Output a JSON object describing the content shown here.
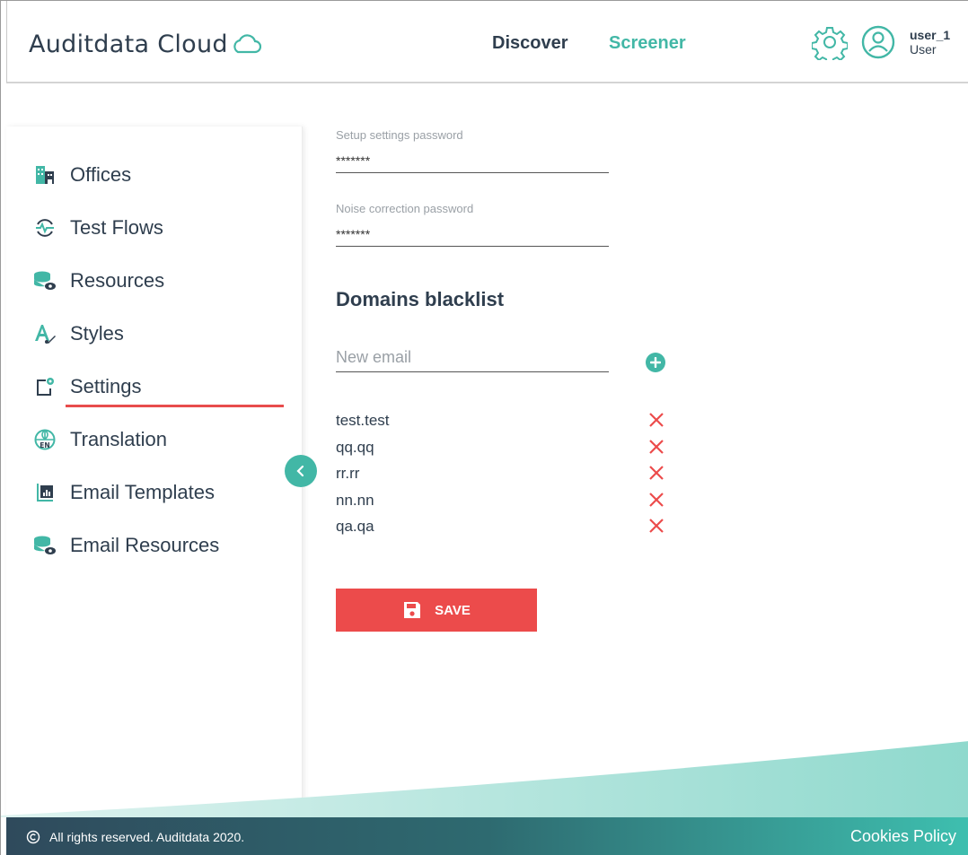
{
  "header": {
    "logo_text": "Auditdata Cloud",
    "nav": [
      {
        "label": "Discover",
        "active": false
      },
      {
        "label": "Screener",
        "active": true
      }
    ],
    "user": {
      "name": "user_1",
      "role": "User"
    }
  },
  "sidebar": {
    "items": [
      {
        "label": "Offices",
        "icon": "building-icon"
      },
      {
        "label": "Test Flows",
        "icon": "test-flow-icon"
      },
      {
        "label": "Resources",
        "icon": "database-eye-icon"
      },
      {
        "label": "Styles",
        "icon": "font-brush-icon"
      },
      {
        "label": "Settings",
        "icon": "device-gear-icon",
        "active": true
      },
      {
        "label": "Translation",
        "icon": "globe-en-icon"
      },
      {
        "label": "Email Templates",
        "icon": "report-file-icon"
      },
      {
        "label": "Email Resources",
        "icon": "database-eye-icon"
      }
    ]
  },
  "form": {
    "setup_password": {
      "label": "Setup settings password",
      "value": "*******"
    },
    "noise_password": {
      "label": "Noise correction password",
      "value": "*******"
    },
    "blacklist": {
      "title": "Domains blacklist",
      "placeholder": "New email",
      "domains": [
        "test.test",
        "qq.qq",
        "rr.rr",
        "nn.nn",
        "qa.qa"
      ]
    },
    "save_label": "SAVE"
  },
  "footer": {
    "copyright": "All rights reserved. Auditdata 2020.",
    "cookies_label": "Cookies Policy"
  },
  "colors": {
    "accent": "#42b7a6",
    "danger": "#ec4b4b",
    "text": "#2f3e4e"
  }
}
